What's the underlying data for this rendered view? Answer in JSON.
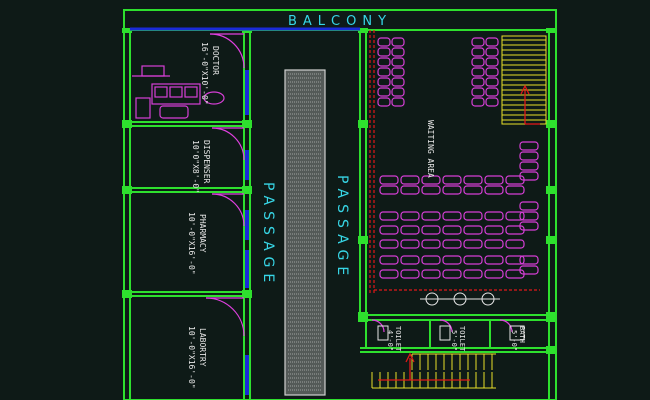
{
  "labels": {
    "balcony": "BALCONY",
    "passage_left": "PASSAGE",
    "passage_right": "PASSAGE",
    "waiting_area": "WAITING AREA"
  },
  "rooms": [
    {
      "name": "DOCTOR",
      "dims": "16'-0\"X10'-0\""
    },
    {
      "name": "DISPENSER",
      "dims": "10'0\"X8'-0\""
    },
    {
      "name": "PHARMACY",
      "dims": "10'-0\"X16'-0\""
    },
    {
      "name": "LABORTRY",
      "dims": "10'-0\"X16'-0\""
    }
  ],
  "toilets": [
    {
      "name": "TOILET",
      "dims": "4'-0\""
    },
    {
      "name": "TOILET",
      "dims": "5'-0\""
    },
    {
      "name": "BATH",
      "dims": "5'-0\""
    }
  ],
  "colors": {
    "wall": "#2ee02e",
    "furniture": "#d63fd6",
    "door": "#e040e0",
    "window": "#1a2bd8",
    "red_line": "#e01818",
    "stair": "#e8e02a",
    "text": "#e6e6e6",
    "label_cyan": "#37d6e6"
  }
}
